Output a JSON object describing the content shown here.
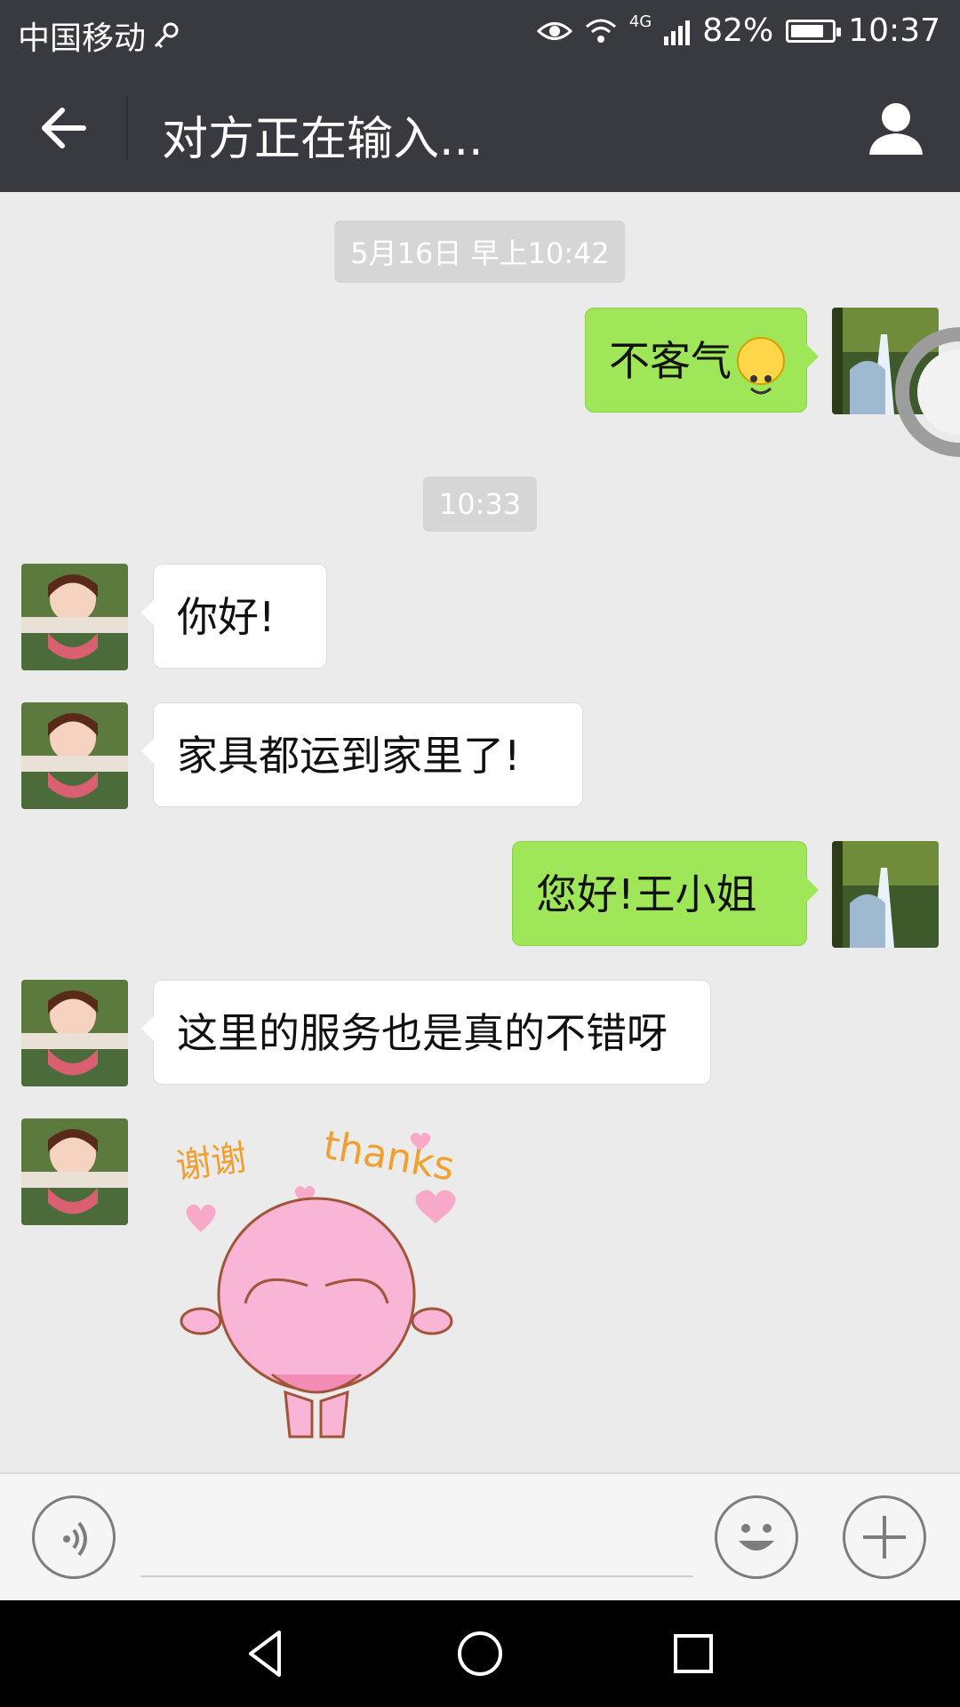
{
  "status": {
    "carrier": "中国移动",
    "network": "4G",
    "battery": "82%",
    "battery_level": 0.82,
    "time": "10:37"
  },
  "header": {
    "title": "对方正在输入..."
  },
  "messages": {
    "time1": "5月16日 早上10:42",
    "time2": "10:33",
    "m1": "不客气",
    "m2": "你好!",
    "m3": "家具都运到家里了!",
    "m4": "您好!王小姐",
    "m5": "这里的服务也是真的不错呀",
    "sticker_left": "谢谢",
    "sticker_right": "thanks"
  },
  "colors": {
    "titlebar": "#393a3f",
    "bubble_out": "#9fe658",
    "bubble_in": "#ffffff",
    "background": "#ebebeb"
  },
  "icons": [
    "key-icon",
    "eye-icon",
    "wifi-icon",
    "signal-icon",
    "battery-icon",
    "back-arrow-icon",
    "person-icon",
    "voice-icon",
    "emoji-icon",
    "plus-icon",
    "nav-back-icon",
    "nav-home-icon",
    "nav-recents-icon",
    "smiley-emoji-icon"
  ]
}
